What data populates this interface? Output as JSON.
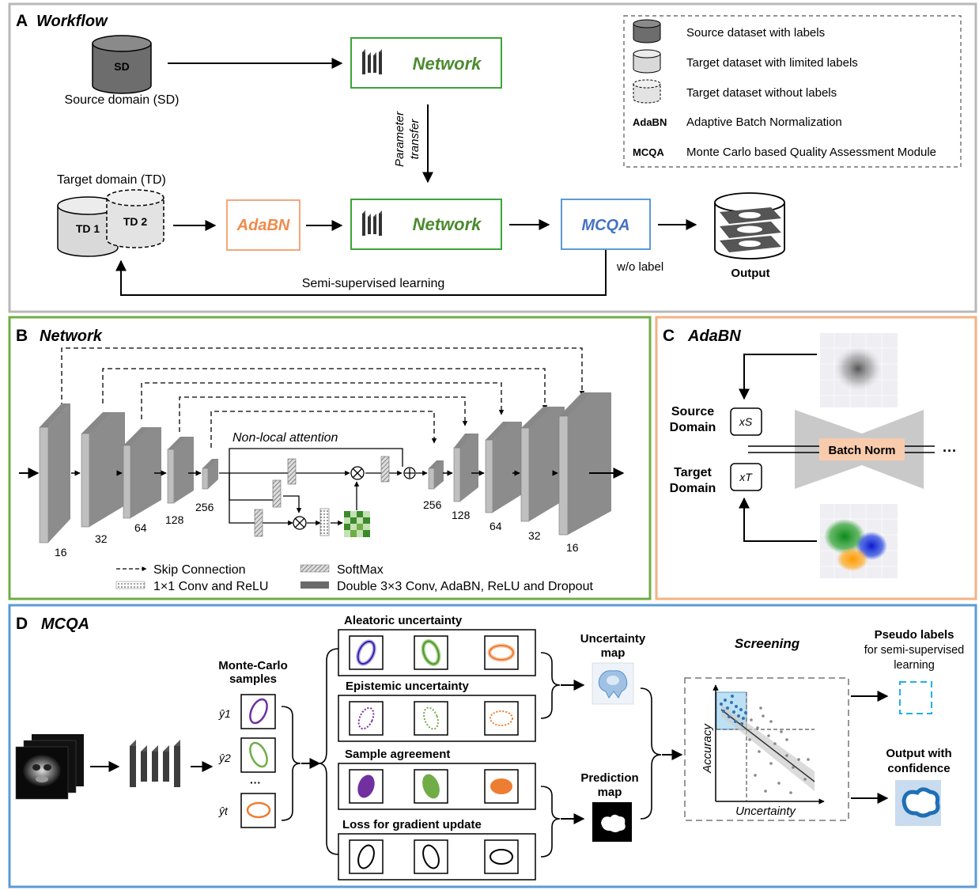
{
  "panels": {
    "a": {
      "letter": "A",
      "title": "Workflow"
    },
    "b": {
      "letter": "B",
      "title": "Network"
    },
    "c": {
      "letter": "C",
      "title": "AdaBN"
    },
    "d": {
      "letter": "D",
      "title": "MCQA"
    }
  },
  "workflow": {
    "sd_label": "SD",
    "source_domain": "Source domain (SD)",
    "network_label": "Network",
    "parameter_transfer_1": "Parameter",
    "parameter_transfer_2": "transfer",
    "target_domain": "Target domain (TD)",
    "td1": "TD 1",
    "td2": "TD 2",
    "adabn": "AdaBN",
    "mcqa": "MCQA",
    "output": "Output",
    "wo_label": "w/o label",
    "semi_supervised": "Semi-supervised learning"
  },
  "legend": {
    "source_dataset": "Source dataset with labels",
    "target_limited": "Target dataset with limited labels",
    "target_without": "Target dataset without labels",
    "adabn_abbr": "AdaBN",
    "adabn_full": "Adaptive Batch Normalization",
    "mcqa_abbr": "MCQA",
    "mcqa_full": "Monte Carlo based Quality Assessment Module"
  },
  "network": {
    "non_local": "Non-local attention",
    "enc_channels": [
      "16",
      "32",
      "64",
      "128",
      "256"
    ],
    "dec_channels": [
      "256",
      "128",
      "64",
      "32",
      "16"
    ],
    "legend_skip": "Skip Connection",
    "legend_softmax": "SoftMax",
    "legend_conv1": "1×1 Conv and ReLU",
    "legend_double": "Double 3×3 Conv, AdaBN, ReLU and Dropout"
  },
  "adabn": {
    "source_domain_1": "Source",
    "source_domain_2": "Domain",
    "target_domain_1": "Target",
    "target_domain_2": "Domain",
    "xs": "xS",
    "xt": "xT",
    "batch_norm": "Batch Norm",
    "ellipsis": "···"
  },
  "mcqa": {
    "mc_samples_1": "Monte-Carlo",
    "mc_samples_2": "samples",
    "y1": "ŷ1",
    "y2": "ŷ2",
    "yt": "ŷt",
    "dots": "···",
    "aleatoric": "Aleatoric uncertainty",
    "epistemic": "Epistemic uncertainty",
    "agreement": "Sample agreement",
    "loss": "Loss for gradient update",
    "uncertainty_map_1": "Uncertainty",
    "uncertainty_map_2": "map",
    "prediction_map_1": "Prediction",
    "prediction_map_2": "map",
    "screening": "Screening",
    "accuracy": "Accuracy",
    "uncertainty": "Uncertainty",
    "pseudo_1": "Pseudo labels",
    "pseudo_2": "for semi-supervised",
    "pseudo_3": "learning",
    "conf_1": "Output with",
    "conf_2": "confidence"
  }
}
